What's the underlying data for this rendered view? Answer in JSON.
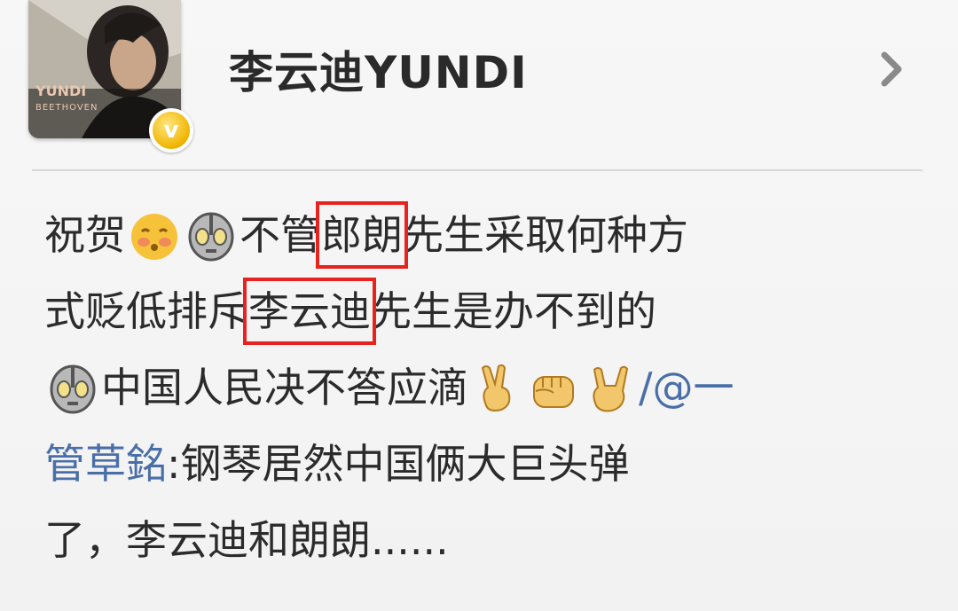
{
  "profile": {
    "name": "李云迪YUNDI",
    "avatar_text_top": "YUNDI",
    "avatar_text_sub": "BEETHOVEN",
    "badge_letter": "v"
  },
  "post": {
    "line1": {
      "before": "祝贺",
      "mid": "不管",
      "highlight": "郎朗",
      "after": "先生采取何种方"
    },
    "line2": {
      "before": "式贬低排斥",
      "highlight": "李云迪",
      "after": "先生是办不到的"
    },
    "line3": {
      "text": "中国人民决不答应滴",
      "tail": "/@一"
    },
    "line4": {
      "mention": "管草銘",
      "text": ":钢琴居然中国俩大巨头弹"
    },
    "line5": {
      "text": "了，李云迪和朗朗......"
    }
  },
  "colors": {
    "highlight_box": "#e8231f",
    "mention": "#4a6fa8",
    "badge": "#f0b400"
  },
  "icons": [
    "chevron-right-icon",
    "verified-badge-icon",
    "shy-face-emoji",
    "ultraman-emoji",
    "victory-hand-emoji",
    "fist-emoji",
    "rock-hand-emoji"
  ]
}
